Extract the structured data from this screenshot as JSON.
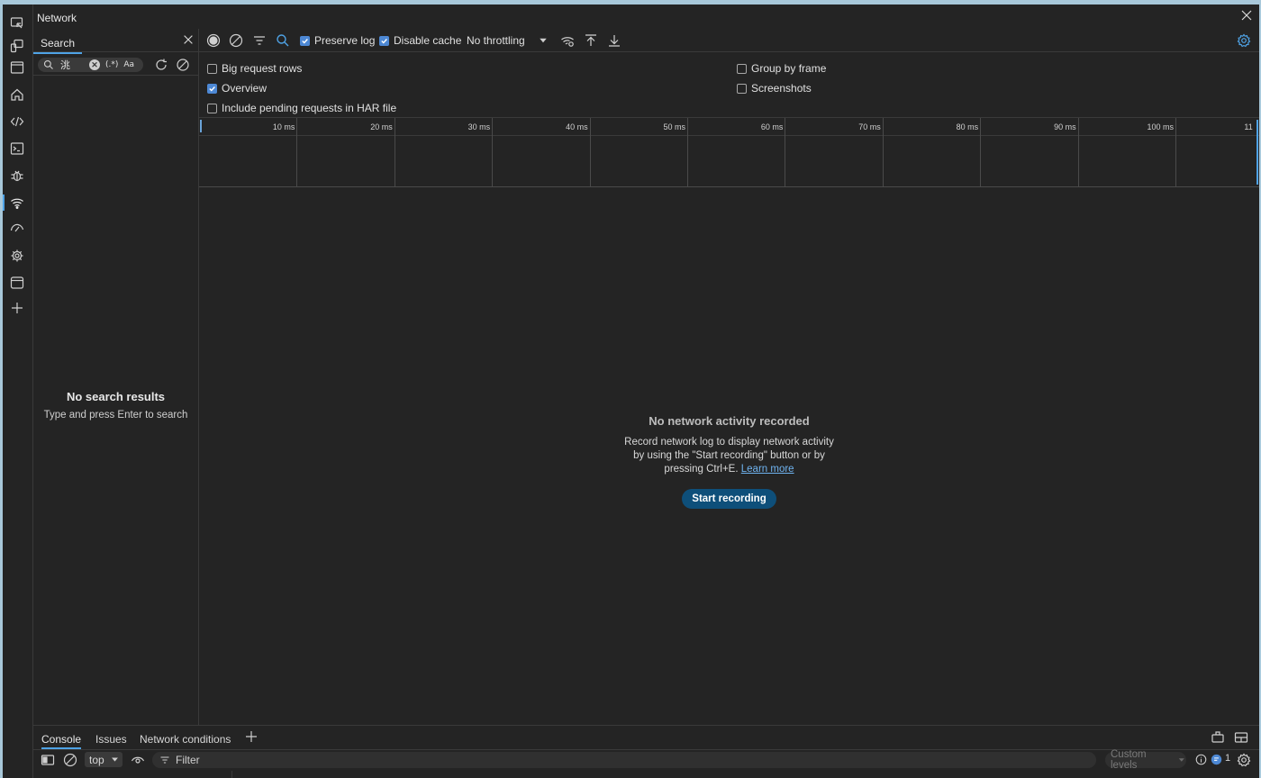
{
  "window": {
    "title": "Network"
  },
  "activity_bar": {
    "items": [
      {
        "icon": "inspect-icon"
      },
      {
        "icon": "device-emulation-icon"
      },
      {
        "icon": "panel-toggle-icon"
      },
      {
        "icon": "home-icon"
      },
      {
        "icon": "elements-icon"
      },
      {
        "icon": "console-icon"
      },
      {
        "icon": "sources-debug-icon"
      },
      {
        "icon": "network-wifi-icon",
        "active": true
      },
      {
        "icon": "performance-icon"
      },
      {
        "icon": "memory-icon"
      },
      {
        "icon": "application-icon"
      },
      {
        "icon": "add-tool-icon"
      }
    ]
  },
  "search_panel": {
    "tab_label": "Search",
    "query": "洮",
    "regex_label": "(.*)",
    "case_label": "Aa",
    "empty_title": "No search results",
    "empty_hint": "Type and press Enter to search"
  },
  "toolbar": {
    "preserve_log": {
      "label": "Preserve log",
      "checked": true
    },
    "disable_cache": {
      "label": "Disable cache",
      "checked": true
    },
    "throttling": "No throttling"
  },
  "settings": {
    "big_request_rows": {
      "label": "Big request rows",
      "checked": false
    },
    "overview": {
      "label": "Overview",
      "checked": true
    },
    "include_pending": {
      "label": "Include pending requests in HAR file",
      "checked": false
    },
    "group_by_frame": {
      "label": "Group by frame",
      "checked": false
    },
    "screenshots": {
      "label": "Screenshots",
      "checked": false
    }
  },
  "timeline": {
    "ticks": [
      "10 ms",
      "20 ms",
      "30 ms",
      "40 ms",
      "50 ms",
      "60 ms",
      "70 ms",
      "80 ms",
      "90 ms",
      "100 ms",
      "11"
    ]
  },
  "empty_state": {
    "title": "No network activity recorded",
    "line1": "Record network log to display network activity",
    "line2": "by using the \"Start recording\" button or by",
    "line3": "pressing Ctrl+E.",
    "learn_more": "Learn more",
    "button": "Start recording"
  },
  "drawer": {
    "tabs": [
      "Console",
      "Issues",
      "Network conditions"
    ],
    "context": "top",
    "filter_placeholder": "Filter",
    "levels": "Custom levels",
    "message_count": "1"
  },
  "colors": {
    "accent": "#4fa3e6",
    "checkbox": "#4d88d4",
    "button": "#0e4f7a",
    "background": "#242424"
  }
}
